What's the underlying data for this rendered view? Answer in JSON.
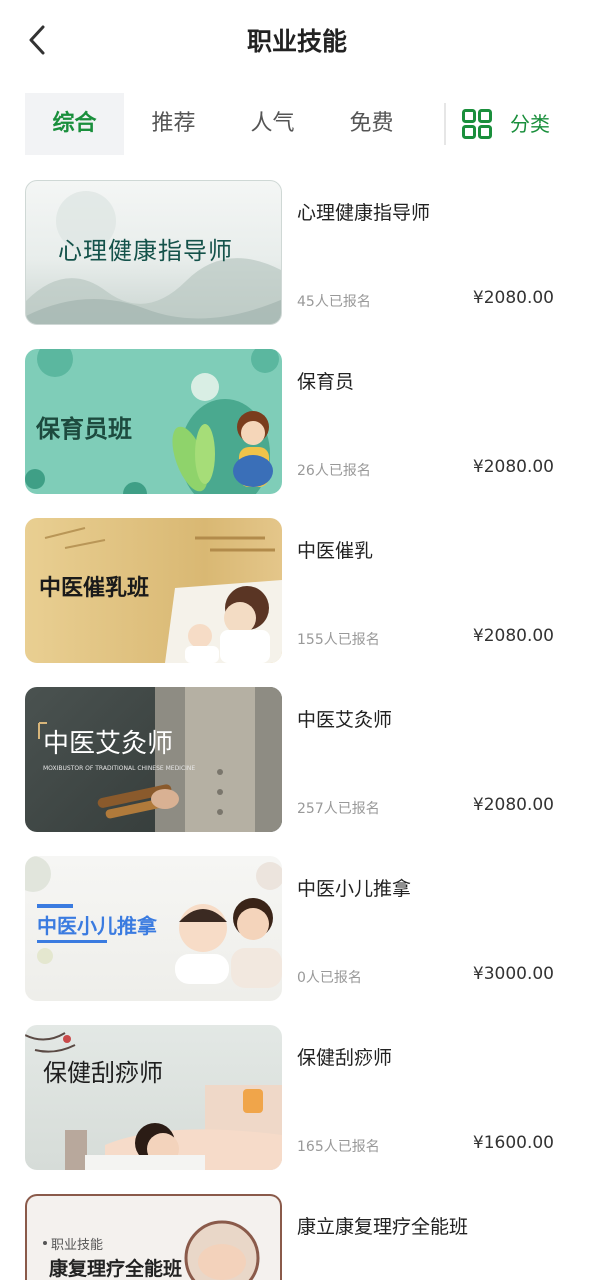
{
  "header": {
    "title": "职业技能"
  },
  "tabs": [
    {
      "label": "综合",
      "active": true
    },
    {
      "label": "推荐",
      "active": false
    },
    {
      "label": "人气",
      "active": false
    },
    {
      "label": "免费",
      "active": false
    }
  ],
  "category": {
    "label": "分类",
    "icon": "grid-icon"
  },
  "colors": {
    "accent": "#1a8f3c",
    "tab_active_bg": "#f2f3f5",
    "text_muted": "#999999"
  },
  "courses": [
    {
      "title": "心理健康指导师",
      "thumb_text": "心理健康指导师",
      "enrolled": "45人已报名",
      "price": "¥2080.00"
    },
    {
      "title": "保育员",
      "thumb_text": "保育员班",
      "enrolled": "26人已报名",
      "price": "¥2080.00"
    },
    {
      "title": "中医催乳",
      "thumb_text": "中医催乳班",
      "enrolled": "155人已报名",
      "price": "¥2080.00"
    },
    {
      "title": "中医艾灸师",
      "thumb_text": "中医艾灸师",
      "thumb_subtext": "MOXIBUSTOR OF TRADITIONAL CHINESE MEDICINE",
      "enrolled": "257人已报名",
      "price": "¥2080.00"
    },
    {
      "title": "中医小儿推拿",
      "thumb_text": "中医小儿推拿",
      "enrolled": "0人已报名",
      "price": "¥3000.00"
    },
    {
      "title": "保健刮痧师",
      "thumb_text": "保健刮痧师",
      "enrolled": "165人已报名",
      "price": "¥1600.00"
    },
    {
      "title": "康立康复理疗全能班",
      "thumb_text": "康复理疗全能班",
      "thumb_tag": "职业技能"
    }
  ]
}
